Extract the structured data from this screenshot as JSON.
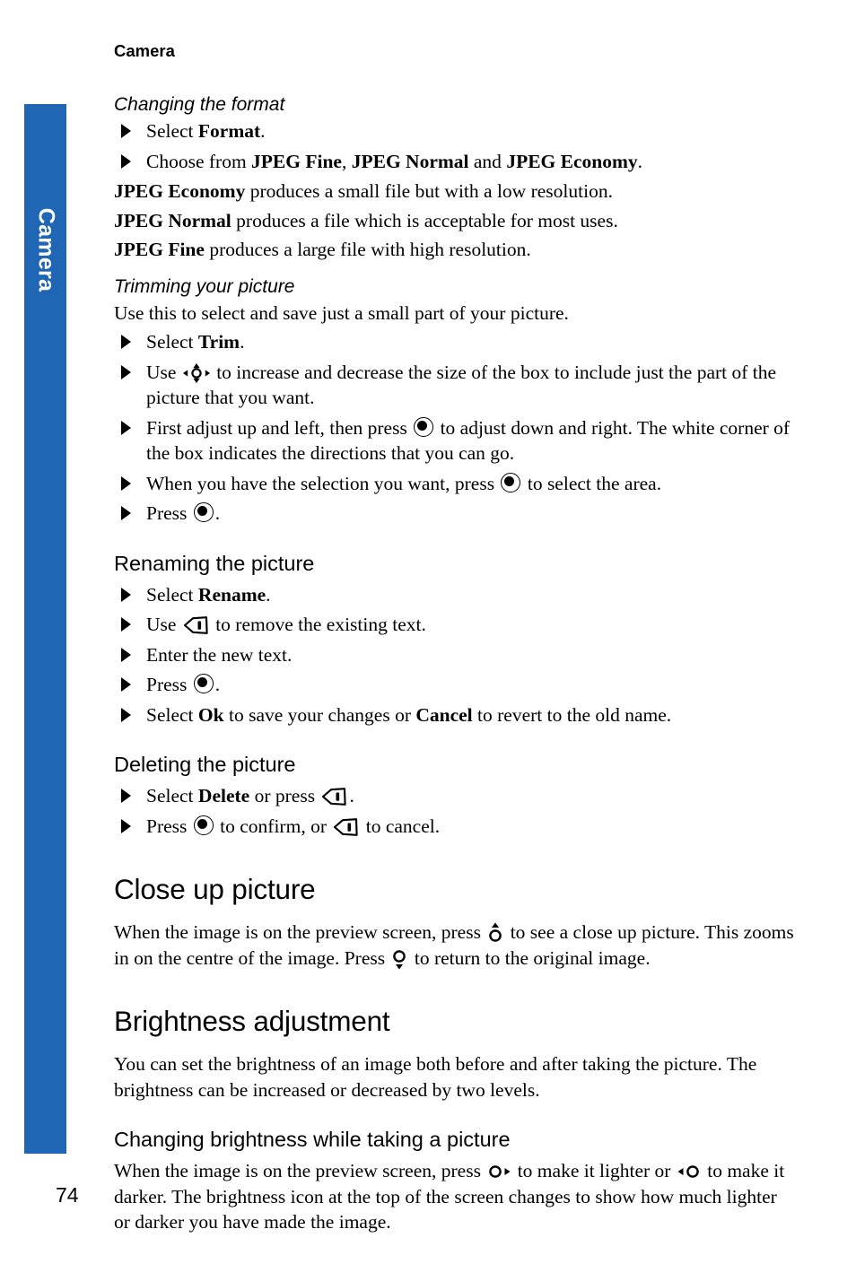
{
  "page": {
    "running_head": "Camera",
    "folio": "74",
    "tab_label": "Camera",
    "tab_color": "#1f66b4"
  },
  "sections": {
    "changing_format": {
      "heading": "Changing the format",
      "steps": [
        {
          "pre": "Select ",
          "bold": "Format",
          "post": "."
        },
        {
          "pre": "Choose from ",
          "bold1": "JPEG Fine",
          "mid1": ", ",
          "bold2": "JPEG Normal",
          "mid2": " and ",
          "bold3": "JPEG Economy",
          "post": "."
        }
      ],
      "paragraphs": [
        {
          "bold": "JPEG Economy",
          "text": " produces a small file but with a low resolution."
        },
        {
          "bold": "JPEG Normal",
          "text": " produces a file which is acceptable for most uses."
        },
        {
          "bold": "JPEG Fine",
          "text": " produces a large file with high resolution."
        }
      ]
    },
    "trimming": {
      "heading": "Trimming your picture",
      "intro": "Use this to select and save just a small part of your picture.",
      "steps": [
        {
          "pre": "Select ",
          "bold": "Trim",
          "post": ".",
          "icon": null
        },
        {
          "pre": "Use ",
          "icon": "nav-4way-icon",
          "post": " to increase and decrease the size of the box to include just the part of the picture that you want."
        },
        {
          "pre": "First adjust up and left, then press ",
          "icon": "select-key-icon",
          "post": " to adjust down and right. The white corner of the box indicates the directions that you can go."
        },
        {
          "pre": "When you have the selection you want, press ",
          "icon": "select-key-icon",
          "post": " to select the area."
        },
        {
          "pre": "Press ",
          "icon": "select-key-icon",
          "post": "."
        }
      ]
    },
    "renaming": {
      "heading": "Renaming the picture",
      "steps": [
        {
          "pre": "Select ",
          "bold": "Rename",
          "post": "."
        },
        {
          "pre": "Use ",
          "icon": "clear-key-icon",
          "post": " to remove the existing text."
        },
        {
          "pre": "Enter the new text.",
          "post": ""
        },
        {
          "pre": "Press ",
          "icon": "select-key-icon",
          "post": "."
        },
        {
          "pre": "Select ",
          "bold": "Ok",
          "mid": " to save your changes or ",
          "bold2": "Cancel",
          "post": " to revert to the old name."
        }
      ]
    },
    "deleting": {
      "heading": "Deleting the picture",
      "steps": [
        {
          "pre": "Select ",
          "bold": "Delete",
          "mid": " or press ",
          "icon": "clear-key-icon",
          "post": "."
        },
        {
          "pre": "Press ",
          "icon": "select-key-icon",
          "mid": " to confirm, or ",
          "icon2": "clear-key-icon",
          "post": " to cancel."
        }
      ]
    },
    "close_up": {
      "heading": "Close up picture",
      "body_pre": "When the image is on the preview screen, press ",
      "icon_up": "nav-up-icon",
      "body_mid": " to see a close up picture. This zooms in on the centre of the image. Press ",
      "icon_down": "nav-down-icon",
      "body_post": " to return to the original image."
    },
    "brightness": {
      "heading": "Brightness adjustment",
      "body": "You can set the brightness of an image both before and after taking the picture. The brightness can be increased or decreased by two levels.",
      "sub_heading": "Changing brightness while taking a picture",
      "sub_pre": "When the image is on the preview screen, press ",
      "icon_right": "nav-right-icon",
      "sub_mid": " to make it lighter or ",
      "icon_left": "nav-left-icon",
      "sub_post": " to make it darker. The brightness icon at the top of the screen changes to show how much lighter or darker you have made the image."
    }
  }
}
